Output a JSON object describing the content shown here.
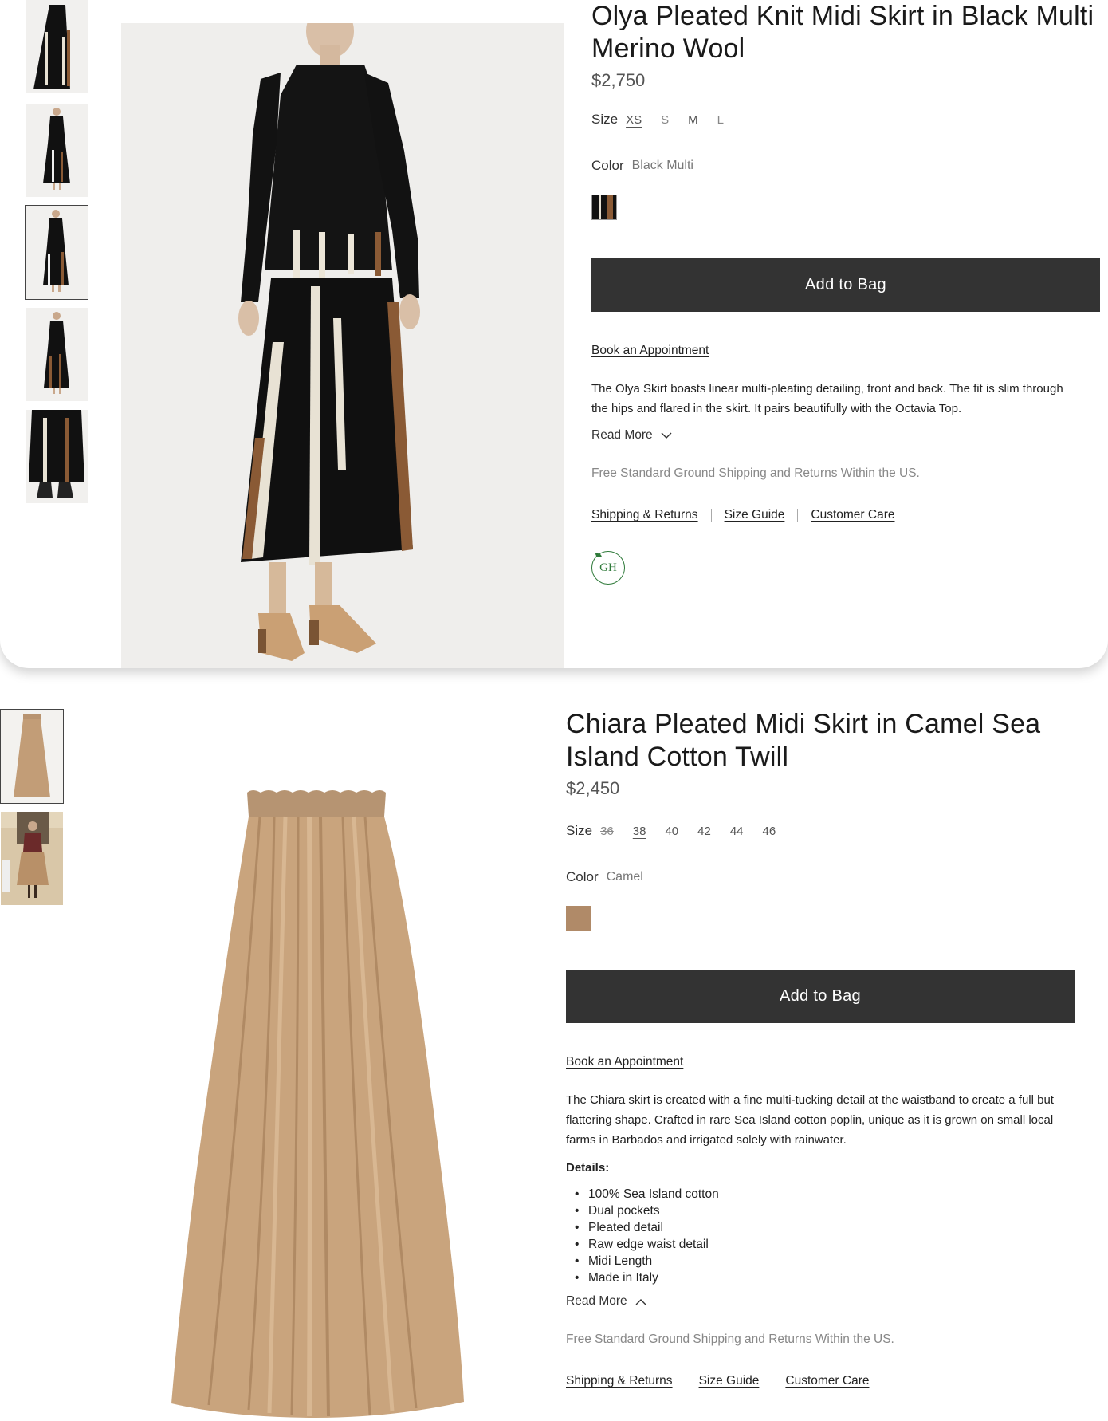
{
  "product1": {
    "title": "Olya Pleated Knit Midi Skirt in Black Multi Merino Wool",
    "price": "$2,750",
    "size_label": "Size",
    "sizes": [
      {
        "label": "XS",
        "state": "selected"
      },
      {
        "label": "S",
        "state": "unavailable"
      },
      {
        "label": "M",
        "state": "available"
      },
      {
        "label": "L",
        "state": "unavailable"
      }
    ],
    "color_label": "Color",
    "color_value": "Black Multi",
    "swatch_colors": [
      "#111111",
      "#8a5a35"
    ],
    "add_to_bag": "Add to Bag",
    "book_appointment": "Book an Appointment",
    "description": "The Olya Skirt boasts linear multi-pleating detailing, front and back. The fit is slim through the hips and flared in the skirt. It pairs beautifully with the Octavia Top.",
    "read_more": "Read More",
    "shipping": "Free Standard Ground Shipping and Returns Within the US.",
    "links": [
      "Shipping & Returns",
      "Size Guide",
      "Customer Care"
    ],
    "badge_text": "GH",
    "thumbnail_count": 5,
    "active_thumbnail_index": 2
  },
  "product2": {
    "title": "Chiara Pleated Midi Skirt in Camel Sea Island Cotton Twill",
    "price": "$2,450",
    "size_label": "Size",
    "sizes": [
      {
        "label": "36",
        "state": "unavailable"
      },
      {
        "label": "38",
        "state": "selected"
      },
      {
        "label": "40",
        "state": "available"
      },
      {
        "label": "42",
        "state": "available"
      },
      {
        "label": "44",
        "state": "available"
      },
      {
        "label": "46",
        "state": "available"
      }
    ],
    "color_label": "Color",
    "color_value": "Camel",
    "swatch_color": "#b08a68",
    "add_to_bag": "Add to Bag",
    "book_appointment": "Book an Appointment",
    "description": "The Chiara skirt is created with a fine multi-tucking detail at the waistband to create a full but flattering shape. Crafted in rare Sea Island cotton poplin, unique as it is grown on small local farms in Barbados and irrigated solely with rainwater.",
    "details_heading": "Details:",
    "details": [
      "100% Sea Island cotton",
      "Dual pockets",
      "Pleated detail",
      "Raw edge waist detail",
      "Midi Length",
      "Made in Italy"
    ],
    "read_more": "Read More",
    "shipping": "Free Standard Ground Shipping and Returns Within the US.",
    "links": [
      "Shipping & Returns",
      "Size Guide",
      "Customer Care"
    ],
    "thumbnail_count": 2,
    "active_thumbnail_index": 0
  }
}
